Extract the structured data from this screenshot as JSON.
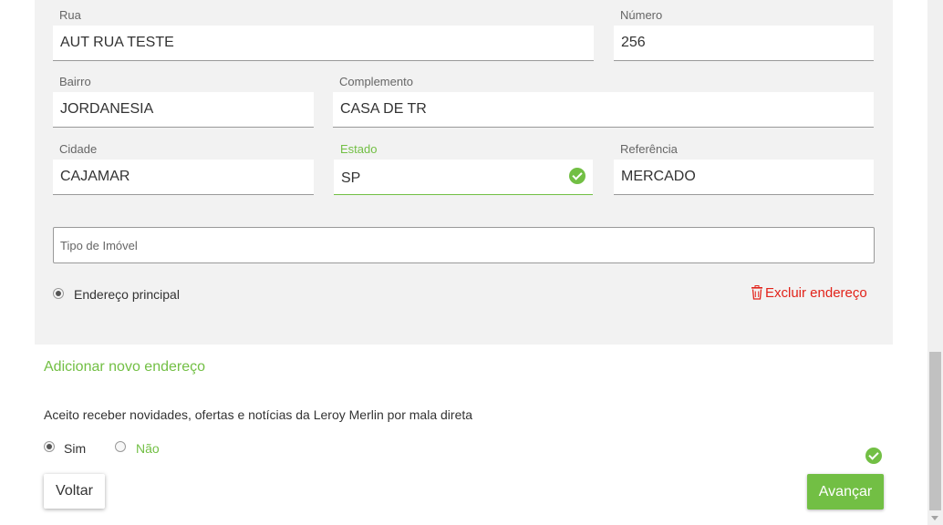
{
  "colors": {
    "accent": "#72bf44",
    "danger": "#e2231a",
    "panel": "#f2f2f2"
  },
  "address": {
    "rua": {
      "label": "Rua",
      "value": "AUT RUA TESTE"
    },
    "numero": {
      "label": "Número",
      "value": "256"
    },
    "bairro": {
      "label": "Bairro",
      "value": "JORDANESIA"
    },
    "complemento": {
      "label": "Complemento",
      "value": "CASA DE TR"
    },
    "cidade": {
      "label": "Cidade",
      "value": "CAJAMAR"
    },
    "estado": {
      "label": "Estado",
      "value": "SP",
      "status_icon": "check-circle-icon"
    },
    "referencia": {
      "label": "Referência",
      "value": "MERCADO"
    },
    "tipo_imovel": {
      "placeholder": "Tipo de Imóvel",
      "value": ""
    },
    "principal_label": "Endereço principal",
    "principal_selected": true,
    "delete_label": "Excluir endereço",
    "delete_icon": "trash-icon"
  },
  "add_address_label": "Adicionar novo endereço",
  "newsletter": {
    "question": "Aceito receber novidades, ofertas e notícias da Leroy Merlin por mala direta",
    "option_yes": "Sim",
    "option_no": "Não",
    "selected": "Sim",
    "status_icon": "check-circle-icon"
  },
  "buttons": {
    "back": "Voltar",
    "next": "Avançar"
  }
}
